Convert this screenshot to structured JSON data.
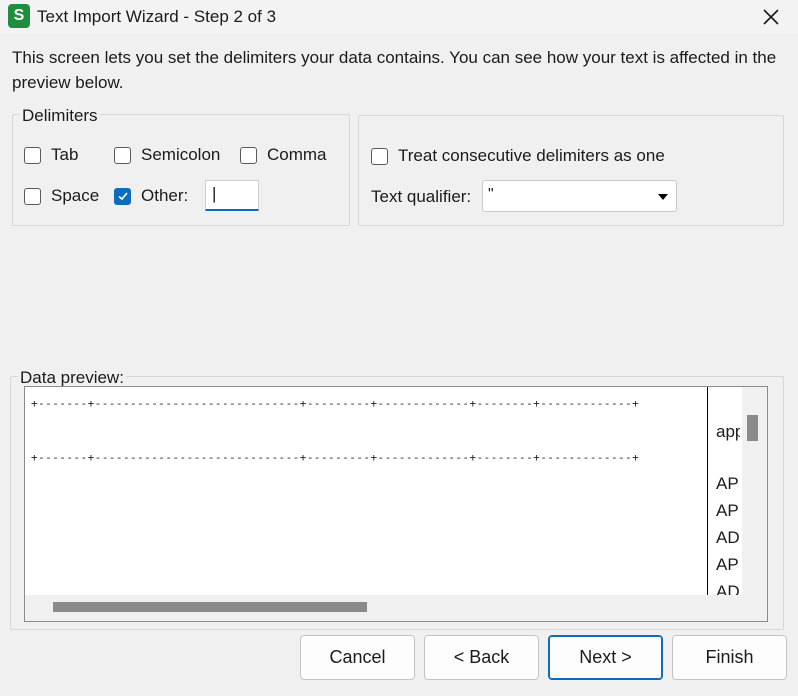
{
  "window": {
    "app_icon": "S",
    "title": "Text Import Wizard - Step 2 of 3",
    "close_icon": "close-icon"
  },
  "description": "This screen lets you set the delimiters your data contains. You can see how your text is affected in the preview below.",
  "delimiters": {
    "legend": "Delimiters",
    "tab": {
      "label": "Tab",
      "checked": false
    },
    "semicolon": {
      "label": "Semicolon",
      "checked": false
    },
    "comma": {
      "label": "Comma",
      "checked": false
    },
    "space": {
      "label": "Space",
      "checked": false
    },
    "other": {
      "label": "Other:",
      "checked": true,
      "value": "|"
    }
  },
  "options": {
    "consecutive": {
      "label": "Treat consecutive delimiters as one",
      "checked": false
    },
    "text_qualifier": {
      "label": "Text qualifier:",
      "value": "\""
    }
  },
  "preview": {
    "legend": "Data preview:",
    "separator_line": "+-------+-----------------------------+---------+-------------+--------+-------------+",
    "column_cells": [
      "app",
      "AP",
      "AP",
      "AD",
      "AP",
      "AD"
    ]
  },
  "buttons": {
    "cancel": "Cancel",
    "back": "< Back",
    "next": "Next >",
    "finish": "Finish"
  },
  "colors": {
    "accent": "#0f6cbd",
    "app_icon": "#1e8e3e"
  }
}
